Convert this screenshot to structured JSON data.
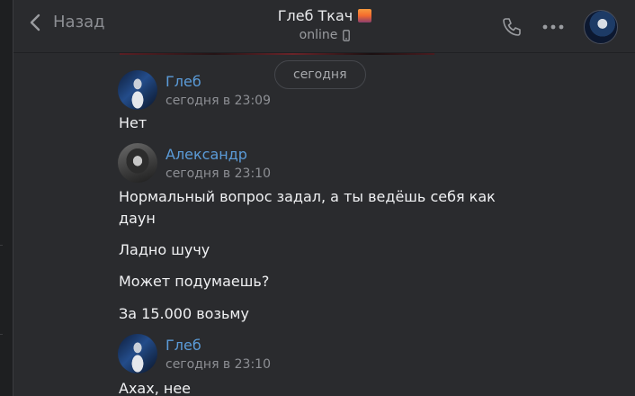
{
  "header": {
    "back_label": "Назад",
    "contact_name": "Глеб Ткач",
    "status": "online",
    "icons": [
      "back-chevron-icon",
      "phone-icon",
      "more-icon",
      "mobile-icon"
    ]
  },
  "feed": {
    "date_separator": "сегодня",
    "messages": [
      {
        "author": "Глеб",
        "time": "сегодня в 23:09",
        "lines": [
          "Нет"
        ]
      },
      {
        "author": "Александр",
        "time": "сегодня в 23:10",
        "lines": [
          "Нормальный вопрос задал, а ты ведёшь себя как даун",
          "Ладно шучу",
          "Может подумаешь?",
          "За 15.000 возьму"
        ]
      },
      {
        "author": "Глеб",
        "time": "сегодня в 23:10",
        "lines": [
          "Ахах, нее"
        ]
      }
    ]
  },
  "colors": {
    "background": "#2a2b2e",
    "author": "#5b9bd8",
    "text": "#f0f1f3",
    "muted": "#8d8f94"
  }
}
